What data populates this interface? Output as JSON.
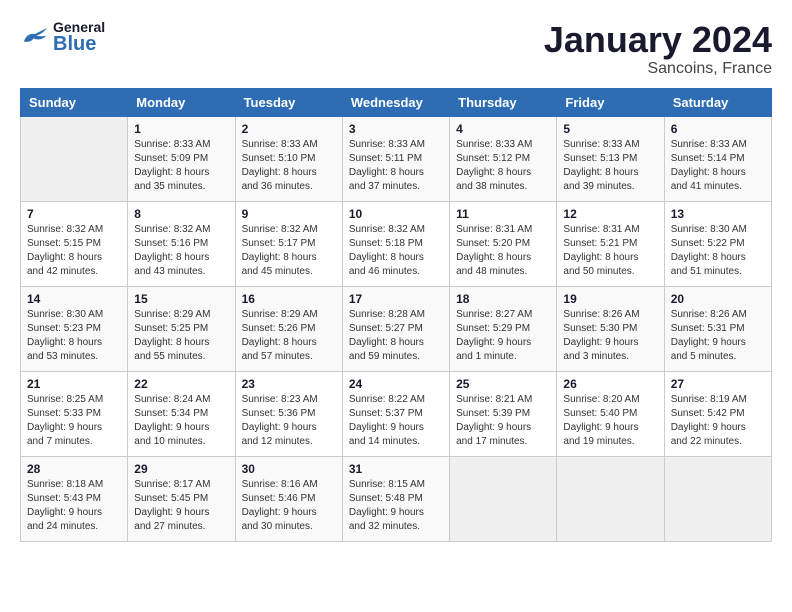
{
  "header": {
    "logo_general": "General",
    "logo_blue": "Blue",
    "month_title": "January 2024",
    "location": "Sancoins, France"
  },
  "days_of_week": [
    "Sunday",
    "Monday",
    "Tuesday",
    "Wednesday",
    "Thursday",
    "Friday",
    "Saturday"
  ],
  "weeks": [
    {
      "days": [
        {
          "number": "",
          "info": ""
        },
        {
          "number": "1",
          "info": "Sunrise: 8:33 AM\nSunset: 5:09 PM\nDaylight: 8 hours\nand 35 minutes."
        },
        {
          "number": "2",
          "info": "Sunrise: 8:33 AM\nSunset: 5:10 PM\nDaylight: 8 hours\nand 36 minutes."
        },
        {
          "number": "3",
          "info": "Sunrise: 8:33 AM\nSunset: 5:11 PM\nDaylight: 8 hours\nand 37 minutes."
        },
        {
          "number": "4",
          "info": "Sunrise: 8:33 AM\nSunset: 5:12 PM\nDaylight: 8 hours\nand 38 minutes."
        },
        {
          "number": "5",
          "info": "Sunrise: 8:33 AM\nSunset: 5:13 PM\nDaylight: 8 hours\nand 39 minutes."
        },
        {
          "number": "6",
          "info": "Sunrise: 8:33 AM\nSunset: 5:14 PM\nDaylight: 8 hours\nand 41 minutes."
        }
      ]
    },
    {
      "days": [
        {
          "number": "7",
          "info": "Sunrise: 8:32 AM\nSunset: 5:15 PM\nDaylight: 8 hours\nand 42 minutes."
        },
        {
          "number": "8",
          "info": "Sunrise: 8:32 AM\nSunset: 5:16 PM\nDaylight: 8 hours\nand 43 minutes."
        },
        {
          "number": "9",
          "info": "Sunrise: 8:32 AM\nSunset: 5:17 PM\nDaylight: 8 hours\nand 45 minutes."
        },
        {
          "number": "10",
          "info": "Sunrise: 8:32 AM\nSunset: 5:18 PM\nDaylight: 8 hours\nand 46 minutes."
        },
        {
          "number": "11",
          "info": "Sunrise: 8:31 AM\nSunset: 5:20 PM\nDaylight: 8 hours\nand 48 minutes."
        },
        {
          "number": "12",
          "info": "Sunrise: 8:31 AM\nSunset: 5:21 PM\nDaylight: 8 hours\nand 50 minutes."
        },
        {
          "number": "13",
          "info": "Sunrise: 8:30 AM\nSunset: 5:22 PM\nDaylight: 8 hours\nand 51 minutes."
        }
      ]
    },
    {
      "days": [
        {
          "number": "14",
          "info": "Sunrise: 8:30 AM\nSunset: 5:23 PM\nDaylight: 8 hours\nand 53 minutes."
        },
        {
          "number": "15",
          "info": "Sunrise: 8:29 AM\nSunset: 5:25 PM\nDaylight: 8 hours\nand 55 minutes."
        },
        {
          "number": "16",
          "info": "Sunrise: 8:29 AM\nSunset: 5:26 PM\nDaylight: 8 hours\nand 57 minutes."
        },
        {
          "number": "17",
          "info": "Sunrise: 8:28 AM\nSunset: 5:27 PM\nDaylight: 8 hours\nand 59 minutes."
        },
        {
          "number": "18",
          "info": "Sunrise: 8:27 AM\nSunset: 5:29 PM\nDaylight: 9 hours\nand 1 minute."
        },
        {
          "number": "19",
          "info": "Sunrise: 8:26 AM\nSunset: 5:30 PM\nDaylight: 9 hours\nand 3 minutes."
        },
        {
          "number": "20",
          "info": "Sunrise: 8:26 AM\nSunset: 5:31 PM\nDaylight: 9 hours\nand 5 minutes."
        }
      ]
    },
    {
      "days": [
        {
          "number": "21",
          "info": "Sunrise: 8:25 AM\nSunset: 5:33 PM\nDaylight: 9 hours\nand 7 minutes."
        },
        {
          "number": "22",
          "info": "Sunrise: 8:24 AM\nSunset: 5:34 PM\nDaylight: 9 hours\nand 10 minutes."
        },
        {
          "number": "23",
          "info": "Sunrise: 8:23 AM\nSunset: 5:36 PM\nDaylight: 9 hours\nand 12 minutes."
        },
        {
          "number": "24",
          "info": "Sunrise: 8:22 AM\nSunset: 5:37 PM\nDaylight: 9 hours\nand 14 minutes."
        },
        {
          "number": "25",
          "info": "Sunrise: 8:21 AM\nSunset: 5:39 PM\nDaylight: 9 hours\nand 17 minutes."
        },
        {
          "number": "26",
          "info": "Sunrise: 8:20 AM\nSunset: 5:40 PM\nDaylight: 9 hours\nand 19 minutes."
        },
        {
          "number": "27",
          "info": "Sunrise: 8:19 AM\nSunset: 5:42 PM\nDaylight: 9 hours\nand 22 minutes."
        }
      ]
    },
    {
      "days": [
        {
          "number": "28",
          "info": "Sunrise: 8:18 AM\nSunset: 5:43 PM\nDaylight: 9 hours\nand 24 minutes."
        },
        {
          "number": "29",
          "info": "Sunrise: 8:17 AM\nSunset: 5:45 PM\nDaylight: 9 hours\nand 27 minutes."
        },
        {
          "number": "30",
          "info": "Sunrise: 8:16 AM\nSunset: 5:46 PM\nDaylight: 9 hours\nand 30 minutes."
        },
        {
          "number": "31",
          "info": "Sunrise: 8:15 AM\nSunset: 5:48 PM\nDaylight: 9 hours\nand 32 minutes."
        },
        {
          "number": "",
          "info": ""
        },
        {
          "number": "",
          "info": ""
        },
        {
          "number": "",
          "info": ""
        }
      ]
    }
  ]
}
